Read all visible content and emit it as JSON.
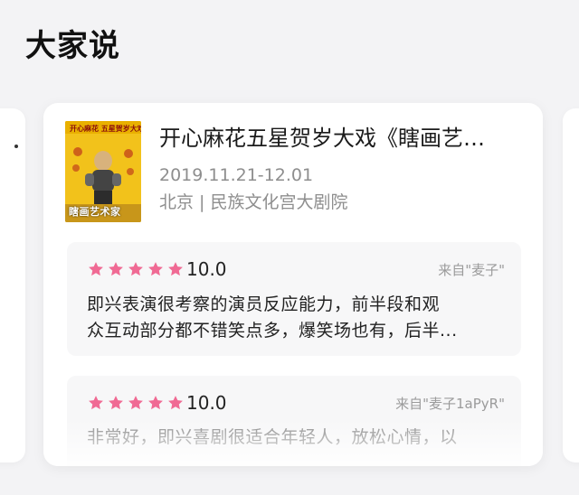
{
  "section": {
    "title": "大家说"
  },
  "show": {
    "title": "开心麻花五星贺岁大戏《瞎画艺…",
    "date": "2019.11.21-12.01",
    "venue": "北京 | 民族文化宫大剧院",
    "poster": {
      "top_text": "开心麻花 五星贺岁大戏",
      "caption": "瞎画艺术家"
    }
  },
  "reviews": [
    {
      "rating_stars": 5,
      "score": "10.0",
      "source": "来自\"麦子\"",
      "text_line_1": "即兴表演很考察的演员反应能力，前半段和观",
      "text_line_2": "众互动部分都不错笑点多，爆笑场也有，后半..."
    },
    {
      "rating_stars": 5,
      "score": "10.0",
      "source": "来自\"麦子1aPyR\"",
      "text_line_1": "非常好，即兴喜剧很适合年轻人，放松心情，以"
    }
  ],
  "colors": {
    "star": "#f06a94",
    "poster_yellow": "#f2c21b"
  }
}
